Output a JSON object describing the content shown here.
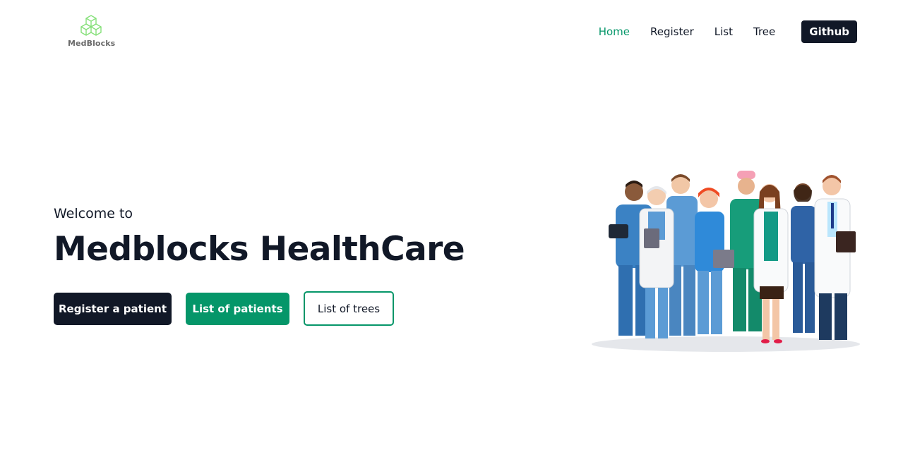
{
  "brand": {
    "name": "MedBlocks",
    "logo_icon": "cubes-icon",
    "logo_color": "#86e07a"
  },
  "nav": {
    "items": [
      {
        "label": "Home",
        "active": true
      },
      {
        "label": "Register",
        "active": false
      },
      {
        "label": "List",
        "active": false
      },
      {
        "label": "Tree",
        "active": false
      }
    ],
    "github_label": "Github"
  },
  "hero": {
    "welcome": "Welcome to",
    "title": "Medblocks HealthCare",
    "buttons": {
      "register": "Register a patient",
      "patients": "List of patients",
      "trees": "List of trees"
    },
    "illustration": "medical-team-illustration"
  },
  "colors": {
    "accent": "#059669",
    "dark": "#111827"
  }
}
